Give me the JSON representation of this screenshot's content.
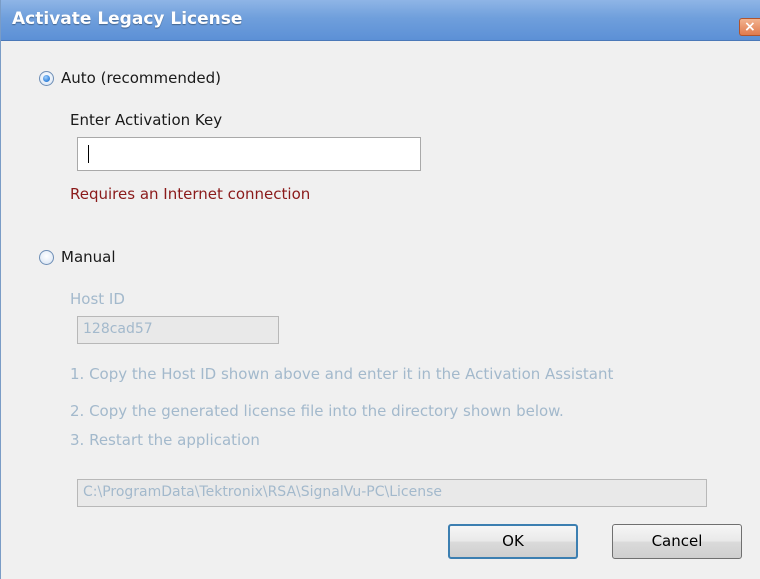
{
  "window": {
    "title": "Activate Legacy License",
    "close_glyph": "×"
  },
  "auto": {
    "radio_label": "Auto (recommended)",
    "checked": true,
    "key_label": "Enter Activation Key",
    "key_value": "",
    "note": "Requires an Internet connection"
  },
  "manual": {
    "radio_label": "Manual",
    "checked": false,
    "host_id_label": "Host ID",
    "host_id_value": "128cad57",
    "step1": "1. Copy the Host ID shown above and enter it in the Activation Assistant",
    "step2": "2. Copy the generated license file into the directory shown below.",
    "step3": "3. Restart the application",
    "license_path": "C:\\ProgramData\\Tektronix\\RSA\\SignalVu-PC\\License"
  },
  "buttons": {
    "ok": "OK",
    "cancel": "Cancel"
  },
  "colors": {
    "titlebar": "#6f9fdc",
    "warning_text": "#8b1a1a",
    "disabled_text": "#a3b9cc",
    "radio_accent": "#2f7fd8"
  }
}
